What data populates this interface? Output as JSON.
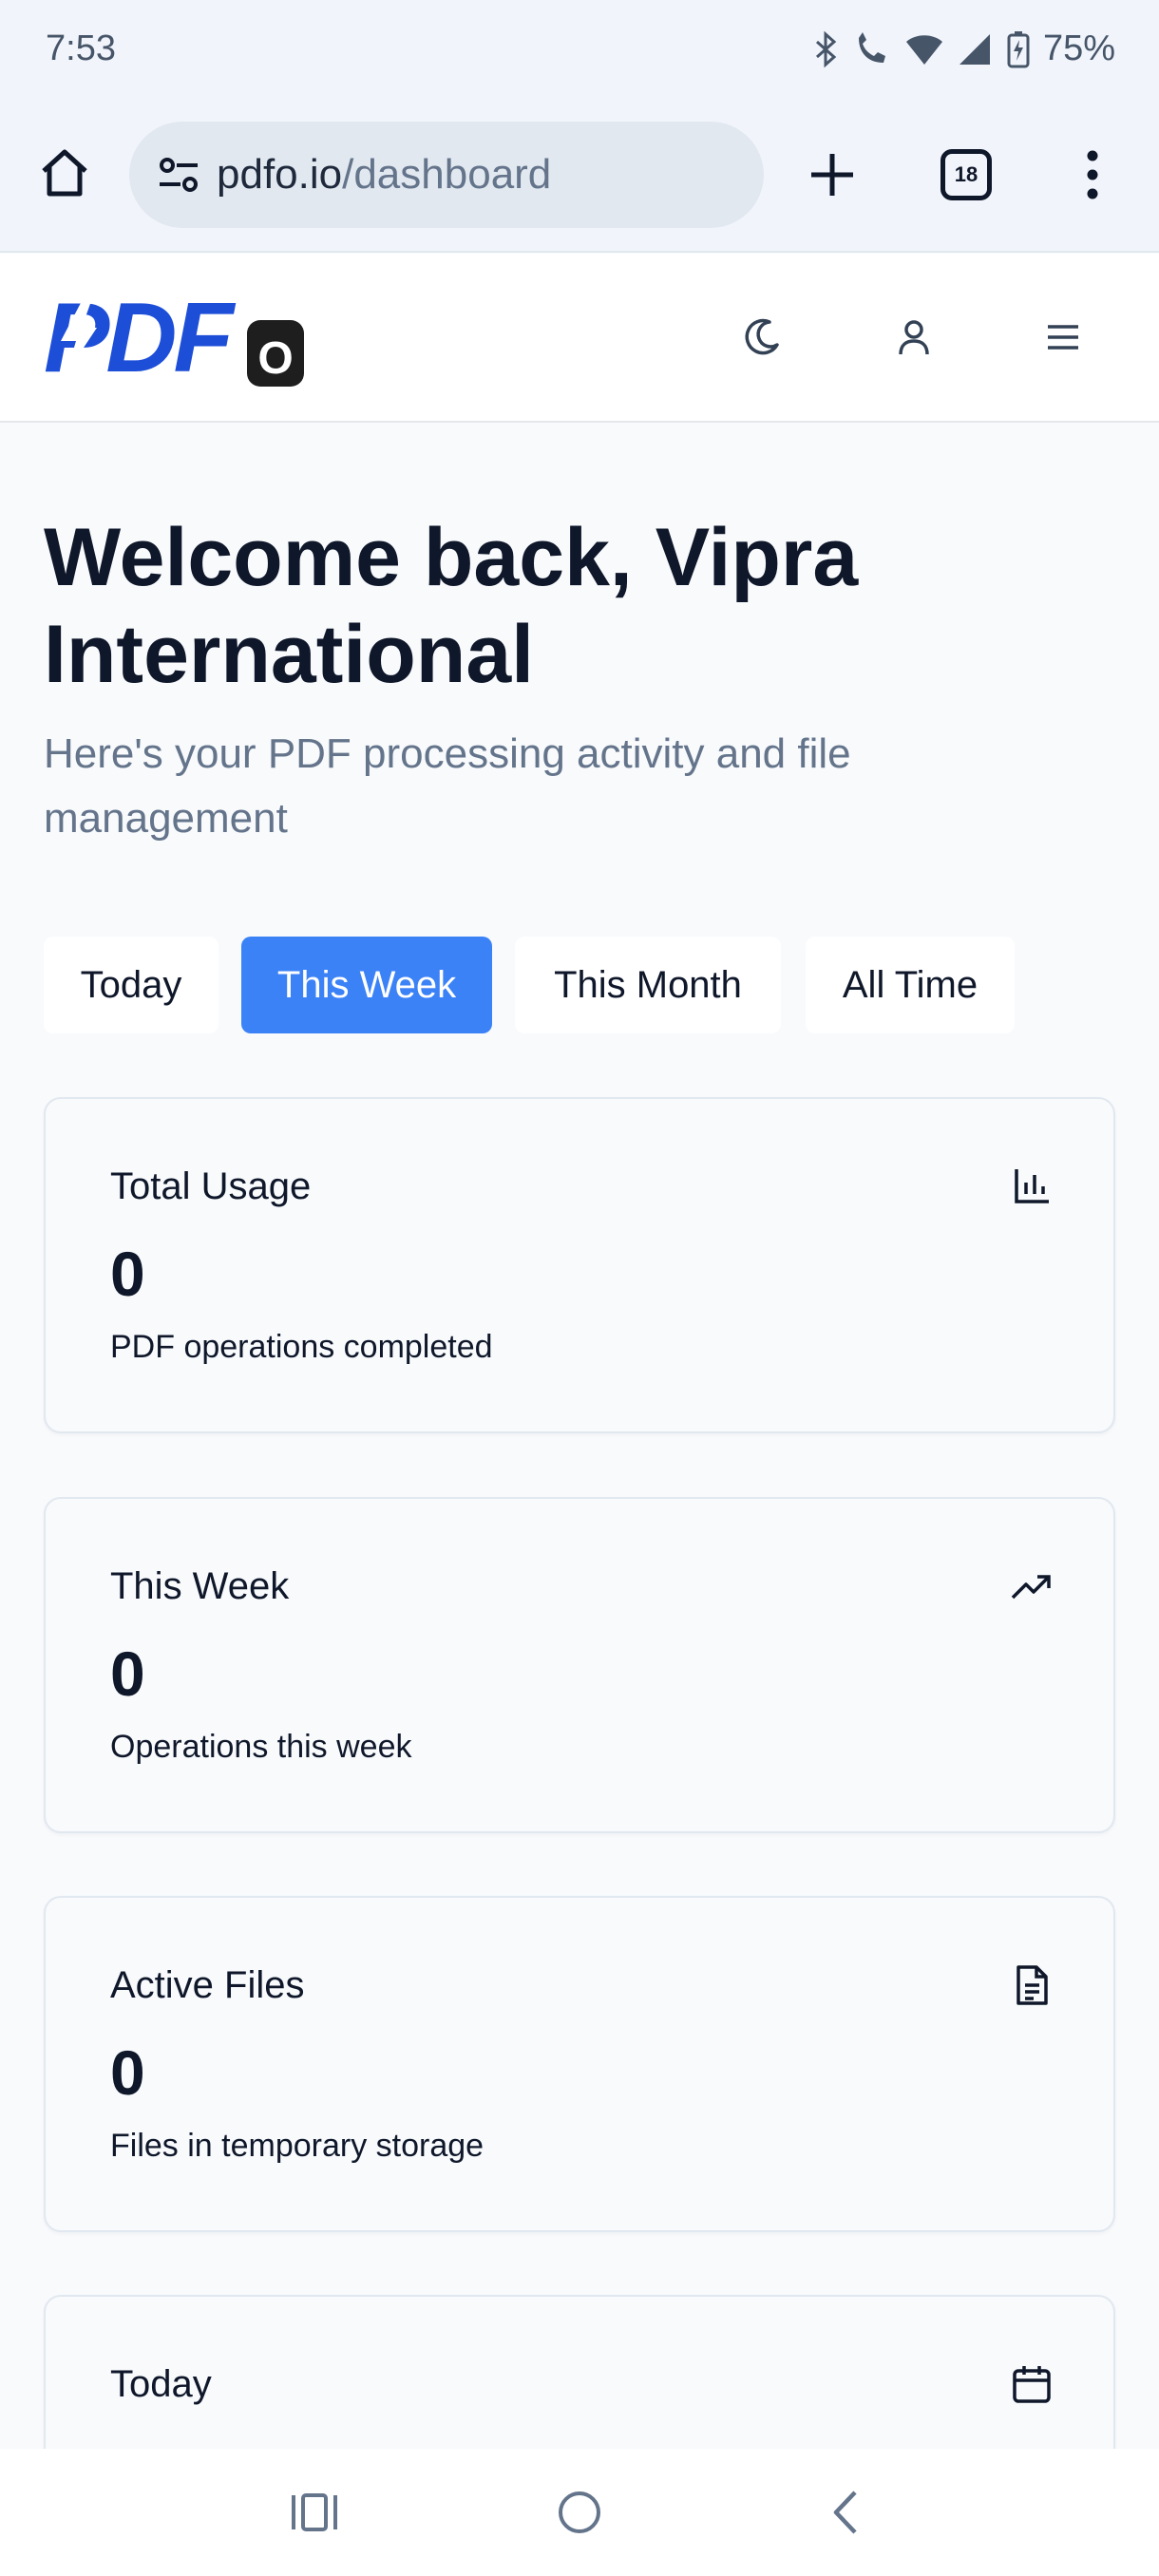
{
  "status_bar": {
    "time": "7:53",
    "battery": "75%"
  },
  "browser": {
    "url_host": "pdfo.io",
    "url_path": "/dashboard",
    "tab_count": "18"
  },
  "header": {
    "logo_text": "PDF",
    "logo_badge": "O"
  },
  "main": {
    "title": "Welcome back, Vipra International",
    "subtitle": "Here's your PDF processing activity and file management",
    "filters": [
      {
        "label": "Today",
        "active": false
      },
      {
        "label": "This Week",
        "active": true
      },
      {
        "label": "This Month",
        "active": false
      },
      {
        "label": "All Time",
        "active": false
      }
    ],
    "cards": [
      {
        "title": "Total Usage",
        "value": "0",
        "description": "PDF operations completed",
        "icon": "bar-chart-icon"
      },
      {
        "title": "This Week",
        "value": "0",
        "description": "Operations this week",
        "icon": "trending-up-icon"
      },
      {
        "title": "Active Files",
        "value": "0",
        "description": "Files in temporary storage",
        "icon": "file-text-icon"
      },
      {
        "title": "Today",
        "icon": "calendar-icon"
      }
    ]
  },
  "colors": {
    "accent": "#3b82f6",
    "logo_blue": "#1d4ed8",
    "text": "#0f172a",
    "muted": "#64748b"
  }
}
